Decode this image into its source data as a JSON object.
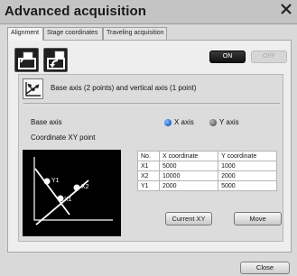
{
  "window": {
    "title": "Advanced acquisition"
  },
  "tabs": [
    {
      "label": "Alignment",
      "active": true
    },
    {
      "label": "Stage coordinates",
      "active": false
    },
    {
      "label": "Traveling acquisition",
      "active": false
    }
  ],
  "toolbar": {
    "open_icon": "open-folder-icon",
    "save_icon": "save-file-icon",
    "on_label": "ON",
    "off_label": "OFF"
  },
  "mode": {
    "label": "Base axis (2 points) and vertical axis (1 point)",
    "icon": "axis-mode-icon"
  },
  "base_axis": {
    "label": "Base axis",
    "options": [
      {
        "label": "X axis",
        "selected": true
      },
      {
        "label": "Y axis",
        "selected": false
      }
    ]
  },
  "coordinate_section": {
    "label": "Coordinate XY point"
  },
  "graph_labels": {
    "y1": "Y1",
    "x1": "X1",
    "x2": "X2"
  },
  "table": {
    "headers": [
      "No.",
      "X coordinate",
      "Y coordinate"
    ],
    "rows": [
      [
        "X1",
        "5000",
        "1000"
      ],
      [
        "X2",
        "10000",
        "2000"
      ],
      [
        "Y1",
        "2000",
        "5000"
      ]
    ]
  },
  "buttons": {
    "current_xy": "Current XY",
    "move": "Move",
    "close": "Close"
  },
  "colors": {
    "selected_radio": "#2a6fd6",
    "unselected_radio": "#6f6f6f",
    "on_bg": "#1a1a1a",
    "off_text": "#a9a9a9"
  }
}
